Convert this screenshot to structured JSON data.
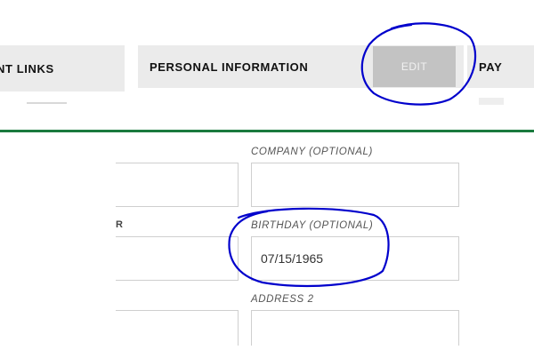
{
  "tabs": {
    "left_partial_label": "NT LINKS",
    "personal_label": "PERSONAL INFORMATION",
    "right_partial_label": "PAY",
    "edit_label": "EDIT"
  },
  "form": {
    "company_label": "COMPANY (OPTIONAL)",
    "company_value": "",
    "left_field_top_value": "",
    "left_partial_label": "R",
    "birthday_label": "BIRTHDAY (OPTIONAL)",
    "birthday_value": "07/15/1965",
    "left_field_mid_value": "",
    "address2_label": "ADDRESS 2",
    "address2_value": "",
    "left_field_bottom_value": ""
  },
  "colors": {
    "divider": "#1a7a3e",
    "annotation": "#0000cc",
    "edit_button_bg": "#c3c3c3"
  }
}
